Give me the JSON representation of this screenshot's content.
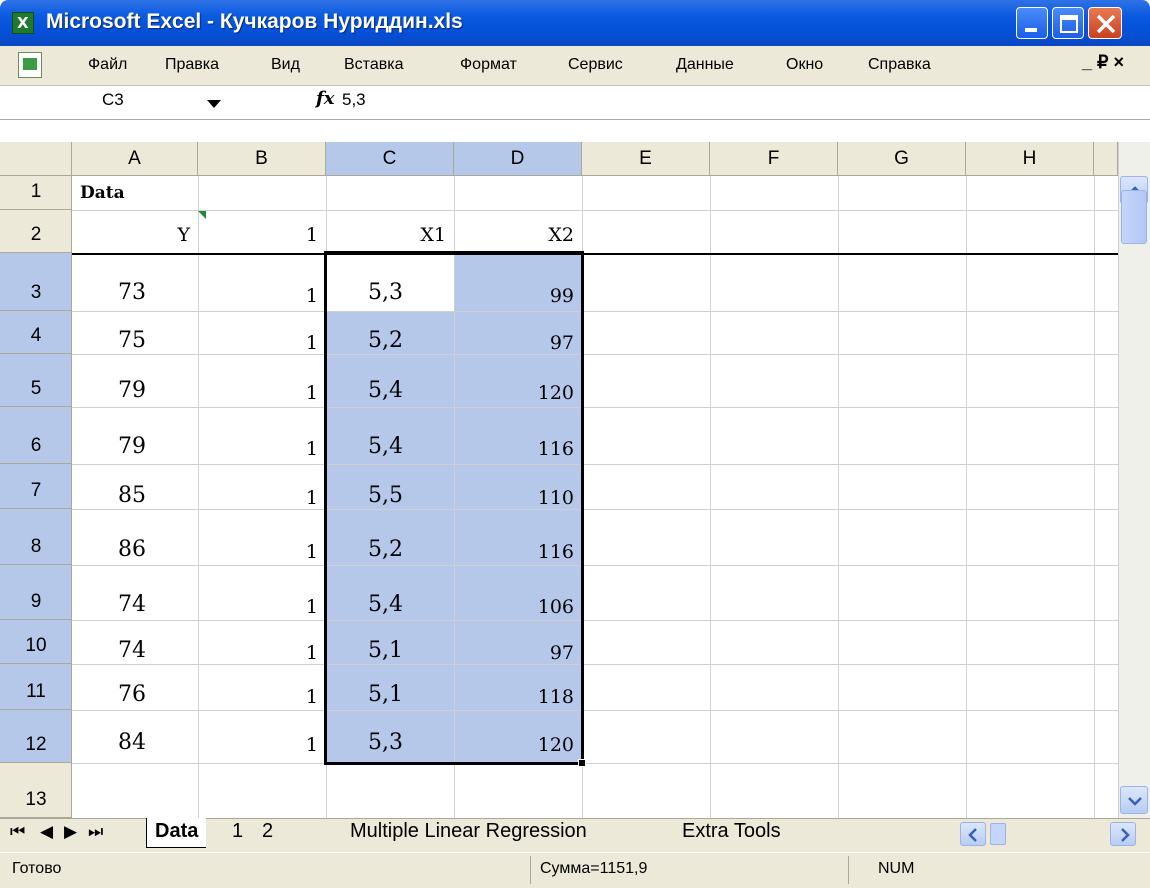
{
  "window": {
    "title": "Microsoft Excel - Кучкаров Нуриддин.xls",
    "app_icon_letter": "X"
  },
  "menu": [
    {
      "label": "Файл"
    },
    {
      "label": "Правка"
    },
    {
      "label": "Вид"
    },
    {
      "label": "Вставка"
    },
    {
      "label": "Формат"
    },
    {
      "label": "Сервис"
    },
    {
      "label": "Данные"
    },
    {
      "label": "Окно"
    },
    {
      "label": "Справка"
    }
  ],
  "mdi_controls": "_ ₽ ×",
  "formula_bar": {
    "name_box": "C3",
    "fx": "fx",
    "formula": "5,3"
  },
  "columns": [
    "A",
    "B",
    "C",
    "D",
    "E",
    "F",
    "G",
    "H"
  ],
  "rows": [
    "1",
    "2",
    "3",
    "4",
    "5",
    "6",
    "7",
    "8",
    "9",
    "10",
    "11",
    "12",
    "13"
  ],
  "sheet": {
    "A1": "Data",
    "header_row": [
      "Y",
      "1",
      "X1",
      "X2"
    ],
    "data": [
      [
        "73",
        "1",
        "5,3",
        "99"
      ],
      [
        "75",
        "1",
        "5,2",
        "97"
      ],
      [
        "79",
        "1",
        "5,4",
        "120"
      ],
      [
        "79",
        "1",
        "5,4",
        "116"
      ],
      [
        "85",
        "1",
        "5,5",
        "110"
      ],
      [
        "86",
        "1",
        "5,2",
        "116"
      ],
      [
        "74",
        "1",
        "5,4",
        "106"
      ],
      [
        "74",
        "1",
        "5,1",
        "97"
      ],
      [
        "76",
        "1",
        "5,1",
        "118"
      ],
      [
        "84",
        "1",
        "5,3",
        "120"
      ]
    ]
  },
  "tabs": {
    "active": "Data",
    "others": [
      "1",
      "2",
      "Multiple Linear Regression",
      "Extra Tools"
    ]
  },
  "status": {
    "ready": "Готово",
    "sum": "Сумма=1151,9",
    "num": "NUM"
  },
  "colors": {
    "title_bar": "#0a5ae0",
    "selection": "#b6c8ea",
    "chrome": "#ece9d8"
  }
}
